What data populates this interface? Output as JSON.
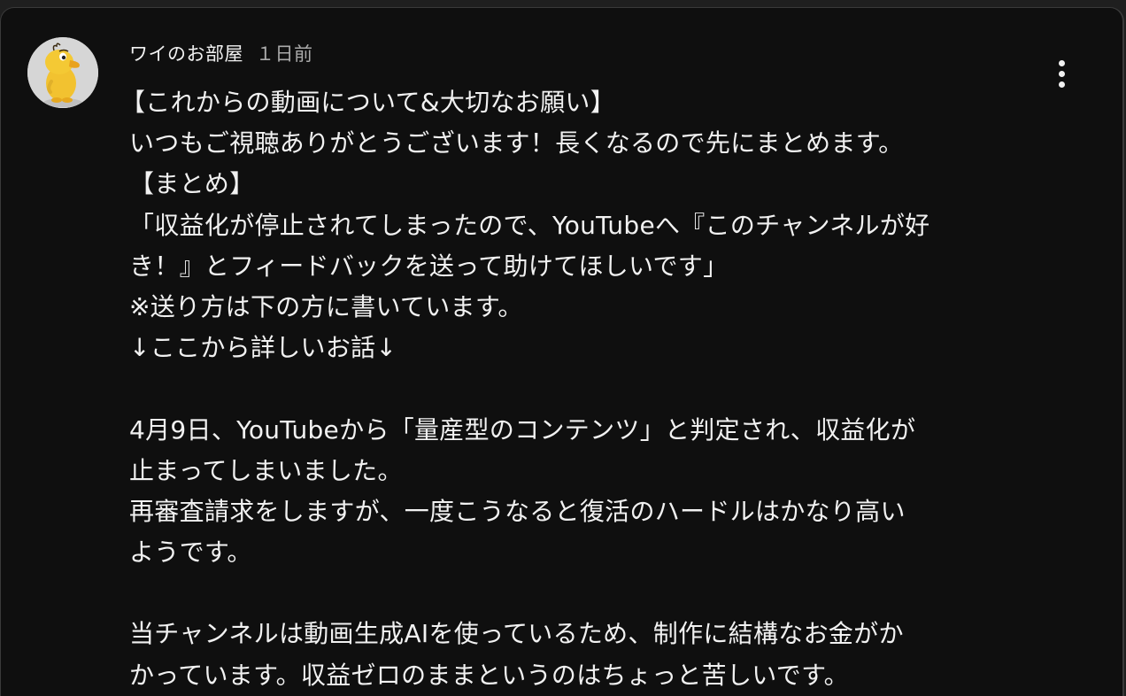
{
  "comment": {
    "author": "ワイのお部屋",
    "time": "１日前",
    "avatar_icon": "yellow-cartoon-character-icon",
    "menu_icon": "more-vertical-icon",
    "lines": [
      "【これからの動画について&大切なお願い】",
      "いつもご視聴ありがとうございます！長くなるので先にまとめます。",
      "【まとめ】",
      "「収益化が停止されてしまったので、YouTubeへ『このチャンネルが好",
      "き！』とフィードバックを送って助けてほしいです」",
      "※送り方は下の方に書いています。",
      "↓ここから詳しいお話↓",
      "",
      "4月9日、YouTubeから「量産型のコンテンツ」と判定され、収益化が",
      "止まってしまいました。",
      "再審査請求をしますが、一度こうなると復活のハードルはかなり高い",
      "ようです。",
      "",
      "当チャンネルは動画生成AIを使っているため、制作に結構なお金がか",
      "かっています。収益ゼロのままというのはちょっと苦しいです。"
    ]
  },
  "colors": {
    "background": "#0f0f0f",
    "text": "#f1f1f1",
    "secondary_text": "#aaaaaa"
  }
}
